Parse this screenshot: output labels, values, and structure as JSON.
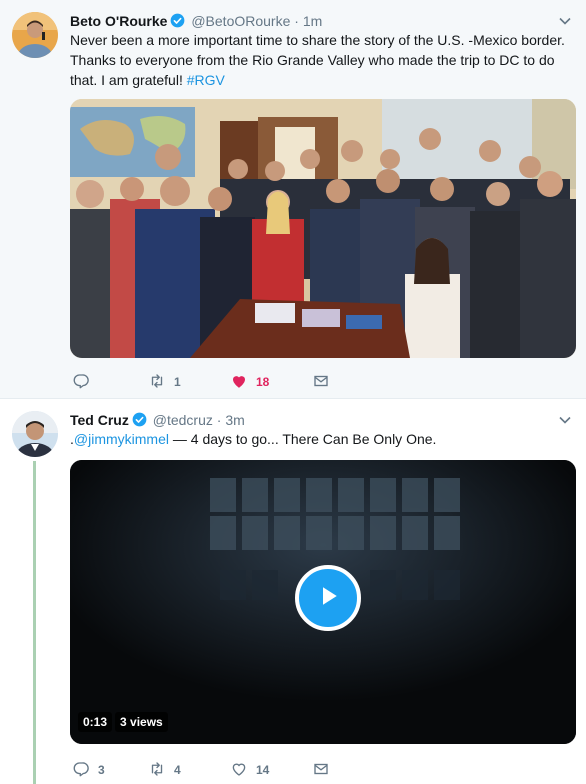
{
  "tweets": [
    {
      "name": "Beto O'Rourke",
      "handle": "@BetoORourke",
      "separator": "·",
      "time": "1m",
      "text_before": "Never been a more important time to share the story of the U.S. -Mexico border. Thanks to everyone from the Rio Grande Valley who made the trip to DC to do that. I am grateful! ",
      "hashtag": "#RGV",
      "replies": "",
      "retweets": "1",
      "likes": "18",
      "liked": true
    },
    {
      "name": "Ted Cruz",
      "handle": "@tedcruz",
      "separator": "·",
      "time": "3m",
      "text_prefix": ".",
      "mention": "@jimmykimmel",
      "text_after": " — 4 days to go... There Can Be Only One.",
      "video_duration": "0:13",
      "video_views": "3 views",
      "replies": "3",
      "retweets": "4",
      "likes": "14",
      "liked": false
    }
  ],
  "colors": {
    "accent": "#1da1f2",
    "like": "#e0245e",
    "muted": "#657786",
    "thread": "#aad0b2"
  },
  "icons": [
    "verified-icon",
    "caret-down-icon",
    "reply-icon",
    "retweet-icon",
    "heart-icon",
    "message-icon",
    "play-icon"
  ]
}
